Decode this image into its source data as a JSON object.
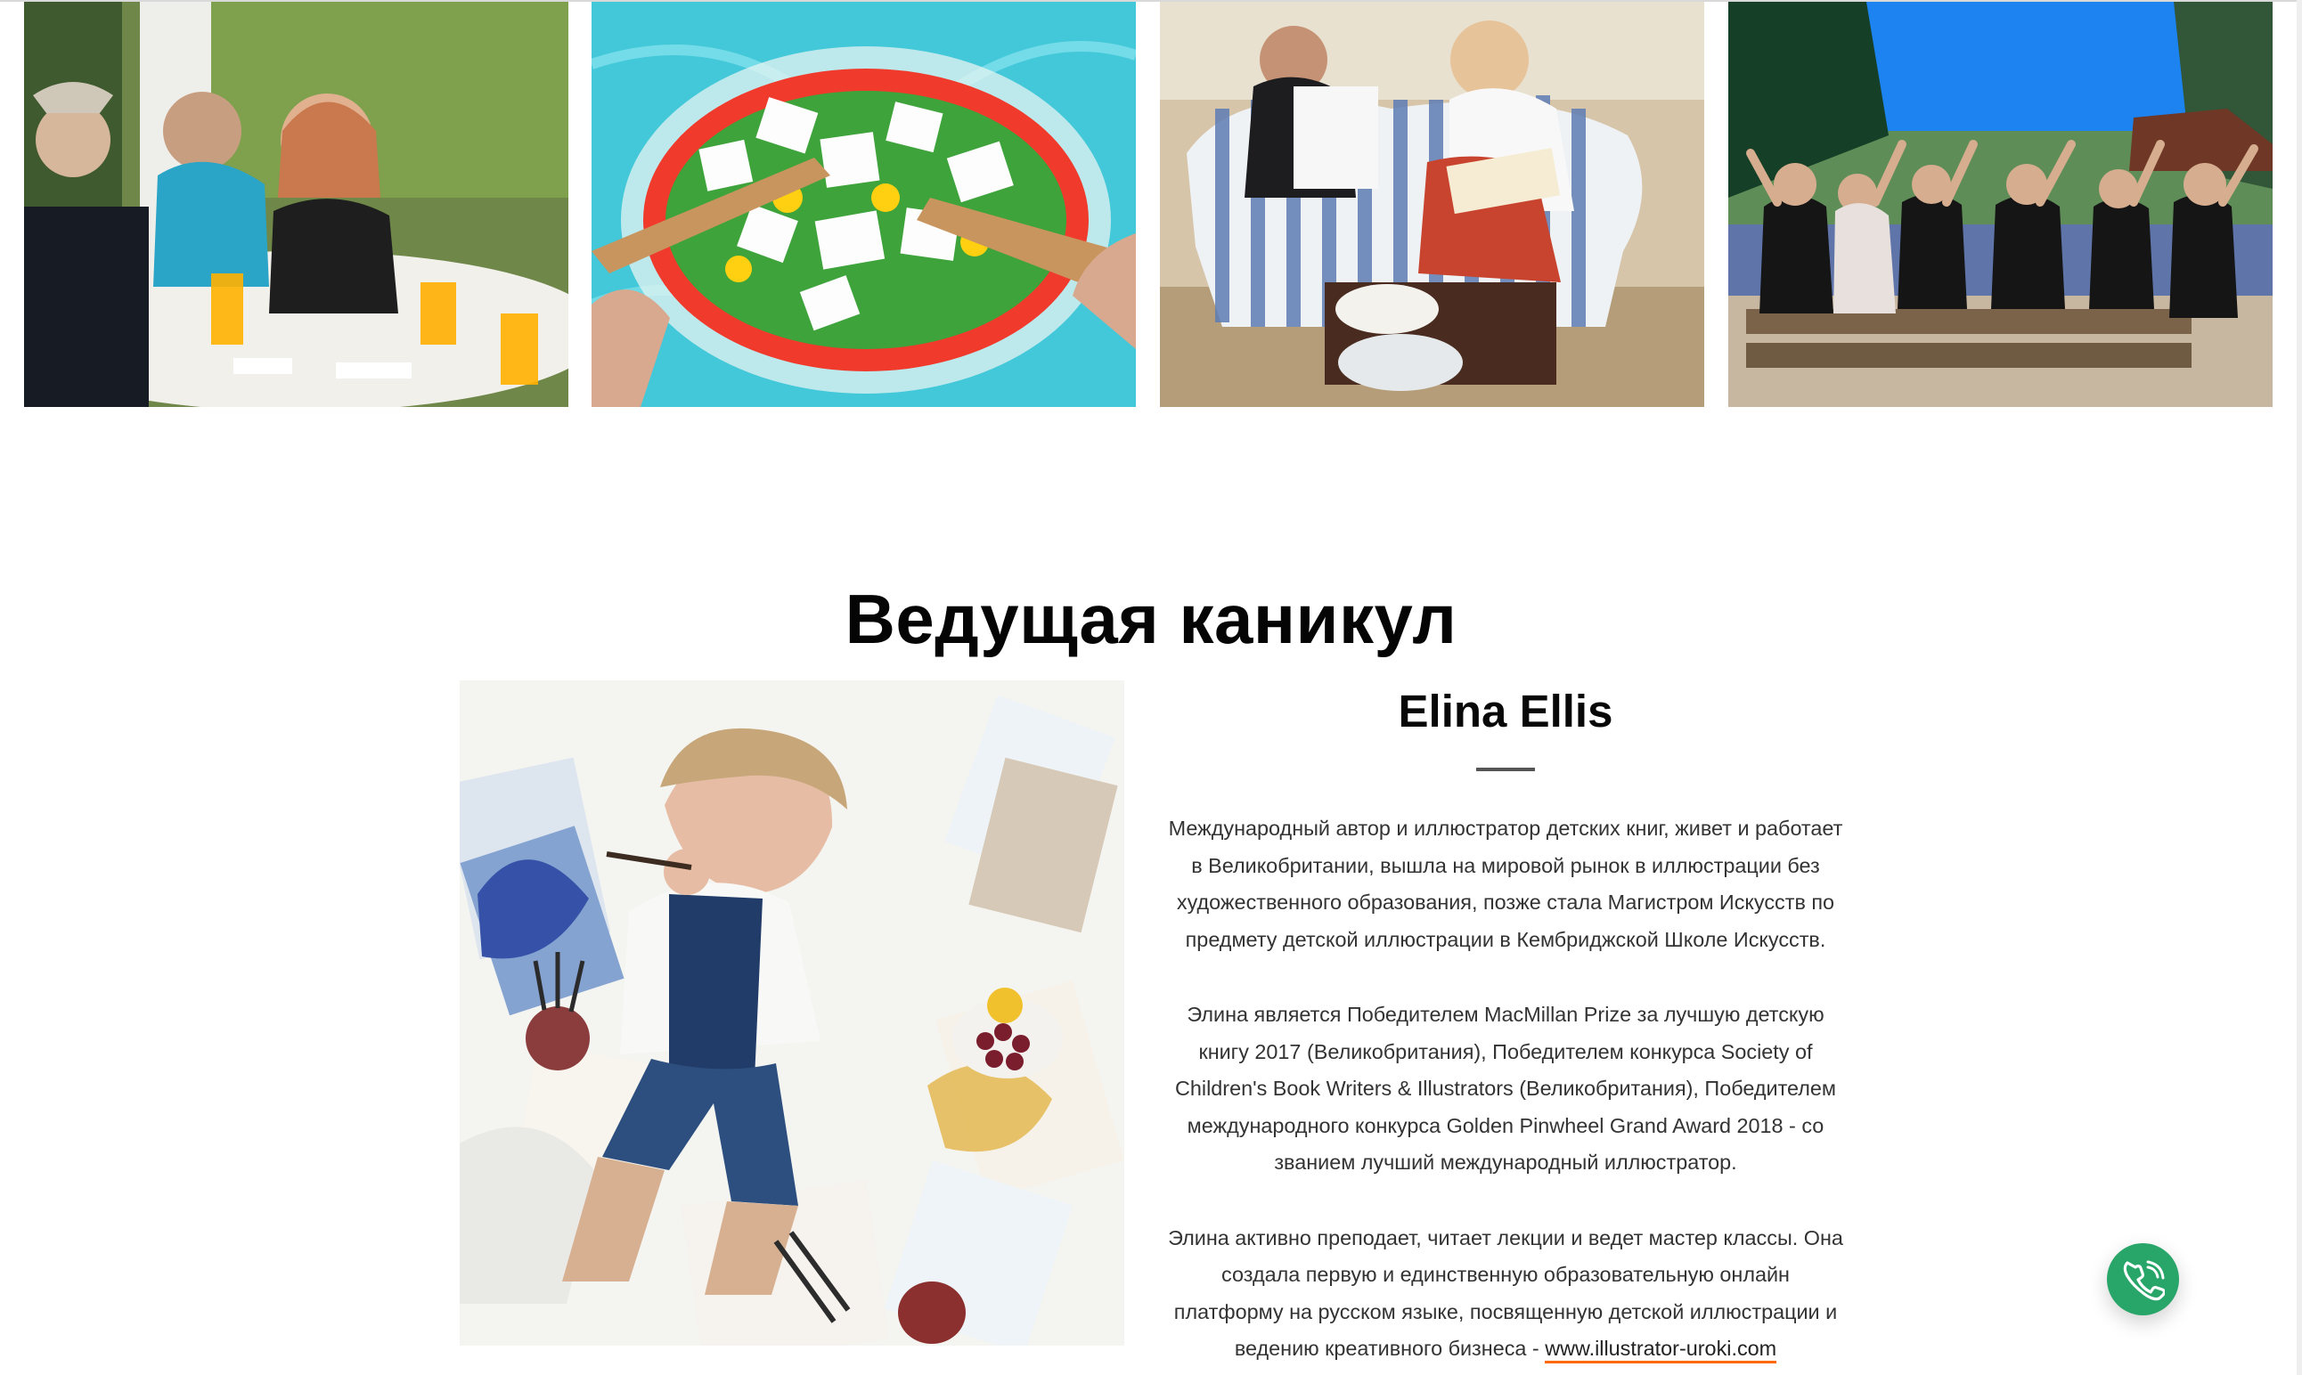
{
  "section": {
    "title": "Ведущая каникул"
  },
  "gallery": {
    "images": [
      "group-breakfast-photo",
      "greek-salad-photo",
      "sketching-on-sofa-photo",
      "group-outdoor-photo"
    ]
  },
  "host": {
    "name": "Elina Ellis",
    "paragraph1": "Международный автор и иллюстратор детских книг, живет и работает в Великобритании, вышла на мировой рынок в иллюстрации без художественного образования, позже стала Магистром Искусств по предмету детской иллюстрации в Кембриджской Школе Искусств.",
    "paragraph2": "Элина является Победителем MacMillan Prize за лучшую детскую книгу 2017 (Великобритания), Победителем конкурса Society of Children's Book Writers & Illustrators (Великобритания), Победителем международного конкурса Golden Pinwheel Grand Award 2018 - со званием лучший международный иллюстратор.",
    "paragraph3_text": "Элина активно преподает, читает лекции и ведет мастер классы. Она создала первую и единственную образовательную онлайн платформу на русском языке, посвященную детской иллюстрации и ведению креативного бизнеса - ",
    "paragraph3_link": "www.illustrator-uroki.com"
  },
  "call_button": {
    "icon": "phone-icon"
  },
  "colors": {
    "accent_green": "#28a569",
    "link_underline": "#ff6a00"
  }
}
